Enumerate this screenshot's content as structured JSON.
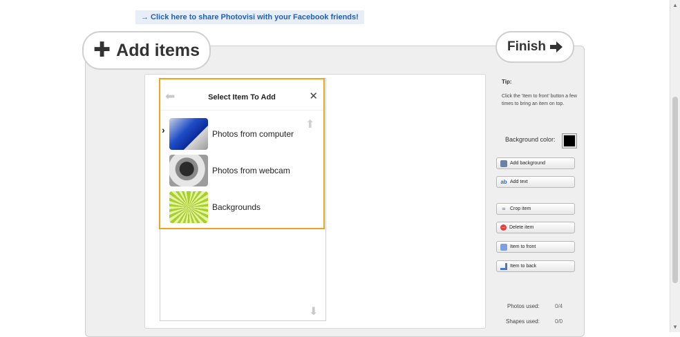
{
  "share_link": "→ Click here to share Photovisi with your Facebook friends!",
  "header": {
    "add_items_label": "Add items",
    "finish_label": "Finish"
  },
  "dialog": {
    "title": "Select Item To Add",
    "items": [
      {
        "label": "Photos from computer"
      },
      {
        "label": "Photos from webcam"
      },
      {
        "label": "Backgrounds"
      }
    ]
  },
  "sidebar": {
    "tip_title": "Tip:",
    "tip_text": "Click the 'Item to front' button a few times to bring an item on top.",
    "background_color_label": "Background color:",
    "background_color": "#000000",
    "buttons": [
      {
        "label": "Add background",
        "icon": "image-icon"
      },
      {
        "label": "Add text",
        "icon": "text-icon"
      },
      {
        "label": "Crop item",
        "icon": "crop-icon"
      },
      {
        "label": "Delete item",
        "icon": "delete-icon"
      },
      {
        "label": "Item to front",
        "icon": "bring-front-icon"
      },
      {
        "label": "Item to back",
        "icon": "send-back-icon"
      }
    ],
    "stats": {
      "photos_label": "Photos used:",
      "photos_value": "0/4",
      "shapes_label": "Shapes used:",
      "shapes_value": "0/0"
    }
  }
}
